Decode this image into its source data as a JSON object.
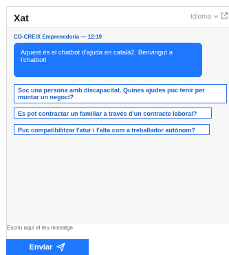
{
  "header": {
    "title": "Xat",
    "language_label": "Idioma"
  },
  "chat": {
    "sender": "CO-CREIX Emprenedoria — 12:19",
    "message": "Aquest és el chatbot d'ajuda en català2. Benvingut a l'chatbot!",
    "options": [
      "Soc una persona amb discapacitat. Quines ajudes puc tenir per muntar un negoci?",
      "Es pot contractar un familiar a través d'un contracte laboral?",
      "Puc compatibilitzar l'atur i l'alta com a treballador autònom?"
    ]
  },
  "composer": {
    "placeholder": "Escriu aquí el teu missatge",
    "send_label": "Enviar"
  },
  "colors": {
    "accent": "#1e78ff",
    "link": "#1a5fbf"
  }
}
